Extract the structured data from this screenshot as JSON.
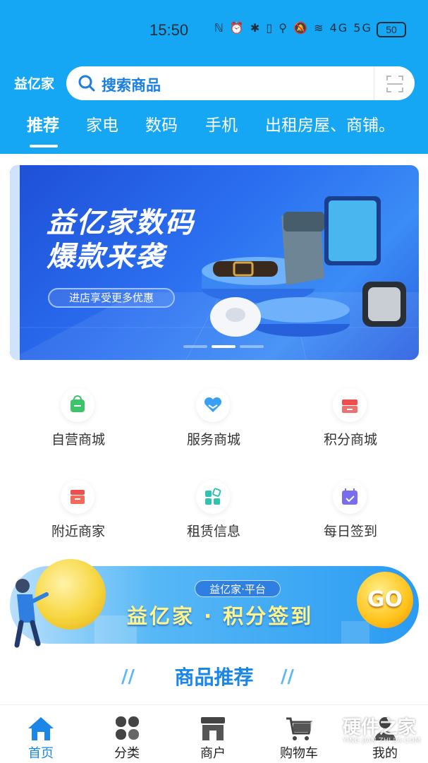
{
  "status_bar": {
    "time": "15:50",
    "icons": "ℕ ⏰ ✱ ▯ ⚲ 🔕 ≋ 4G 5G",
    "battery": "50"
  },
  "header": {
    "logo": "益亿家",
    "search_placeholder": "搜索商品"
  },
  "tabs": [
    "推荐",
    "家电",
    "数码",
    "手机",
    "出租房屋、商铺。"
  ],
  "banner": {
    "title_line1": "益亿家数码",
    "title_line2": "爆款来袭",
    "button": "进店享受更多优惠"
  },
  "grid": [
    {
      "label": "自营商城",
      "icon": "shopping-bag-icon",
      "color": "#3cc46a"
    },
    {
      "label": "服务商城",
      "icon": "heart-hands-icon",
      "color": "#3aa0f5"
    },
    {
      "label": "积分商城",
      "icon": "store-icon",
      "color": "#ef4e4e"
    },
    {
      "label": "附近商家",
      "icon": "shop-nearby-icon",
      "color": "#ef4e4e"
    },
    {
      "label": "租赁信息",
      "icon": "blocks-icon",
      "color": "#2ec4b0"
    },
    {
      "label": "每日签到",
      "icon": "calendar-check-icon",
      "color": "#7a6cf0"
    }
  ],
  "promo": {
    "tag": "益亿家·平台",
    "title": "益亿家 · 积分签到",
    "go": "GO"
  },
  "section": {
    "title": "商品推荐"
  },
  "tabbar": [
    {
      "label": "首页",
      "icon": "home-icon"
    },
    {
      "label": "分类",
      "icon": "category-icon"
    },
    {
      "label": "商户",
      "icon": "merchant-icon"
    },
    {
      "label": "购物车",
      "icon": "cart-icon"
    },
    {
      "label": "我的",
      "icon": "profile-icon"
    }
  ],
  "watermark": {
    "text": "硬件之家",
    "sub": "YING JIAN ZHI JIA.COM"
  }
}
